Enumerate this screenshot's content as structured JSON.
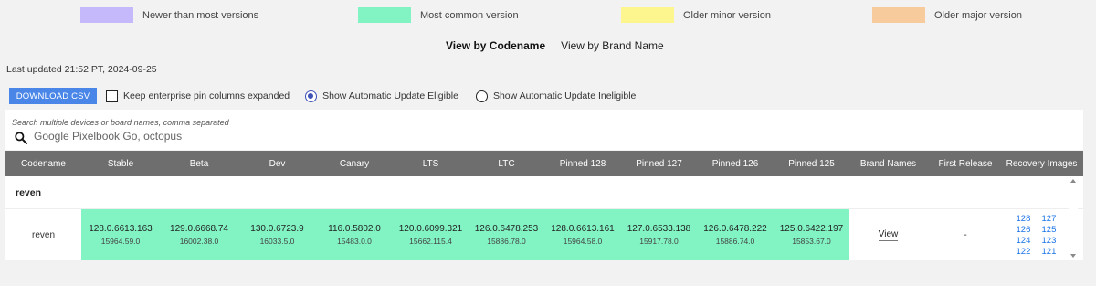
{
  "legend": [
    {
      "label": "Newer than most versions",
      "color": "#c5b8fb"
    },
    {
      "label": "Most common version",
      "color": "#82f4c4"
    },
    {
      "label": "Older minor version",
      "color": "#fdf68f"
    },
    {
      "label": "Older major version",
      "color": "#f8cb9c"
    }
  ],
  "view_toggle": {
    "codename": "View by Codename",
    "brand": "View by Brand Name"
  },
  "last_updated": "Last updated 21:52 PT, 2024-09-25",
  "controls": {
    "download_label": "DOWNLOAD CSV",
    "keep_pins_label": "Keep enterprise pin columns expanded",
    "keep_pins_checked": false,
    "auto_update_eligible_label": "Show Automatic Update Eligible",
    "auto_update_ineligible_label": "Show Automatic Update Ineligible",
    "selected_radio": "eligible"
  },
  "search": {
    "hint": "Search multiple devices or board names, comma separated",
    "placeholder": "Google Pixelbook Go, octopus"
  },
  "table": {
    "headers": [
      "Codename",
      "Stable",
      "Beta",
      "Dev",
      "Canary",
      "LTS",
      "LTC",
      "Pinned 128",
      "Pinned 127",
      "Pinned 126",
      "Pinned 125",
      "Brand Names",
      "First Release",
      "Recovery Images"
    ],
    "group": "reven",
    "rows": [
      {
        "codename": "reven",
        "versions": [
          {
            "main": "128.0.6613.163",
            "sub": "15964.59.0"
          },
          {
            "main": "129.0.6668.74",
            "sub": "16002.38.0"
          },
          {
            "main": "130.0.6723.9",
            "sub": "16033.5.0"
          },
          {
            "main": "116.0.5802.0",
            "sub": "15483.0.0"
          },
          {
            "main": "120.0.6099.321",
            "sub": "15662.115.4"
          },
          {
            "main": "126.0.6478.253",
            "sub": "15886.78.0"
          },
          {
            "main": "128.0.6613.161",
            "sub": "15964.58.0"
          },
          {
            "main": "127.0.6533.138",
            "sub": "15917.78.0"
          },
          {
            "main": "126.0.6478.222",
            "sub": "15886.74.0"
          },
          {
            "main": "125.0.6422.197",
            "sub": "15853.67.0"
          }
        ],
        "version_color": "#82f4c4",
        "brand_names": "View",
        "first_release": "-",
        "recovery_images": [
          "128",
          "127",
          "126",
          "125",
          "124",
          "123",
          "122",
          "121"
        ]
      }
    ]
  }
}
